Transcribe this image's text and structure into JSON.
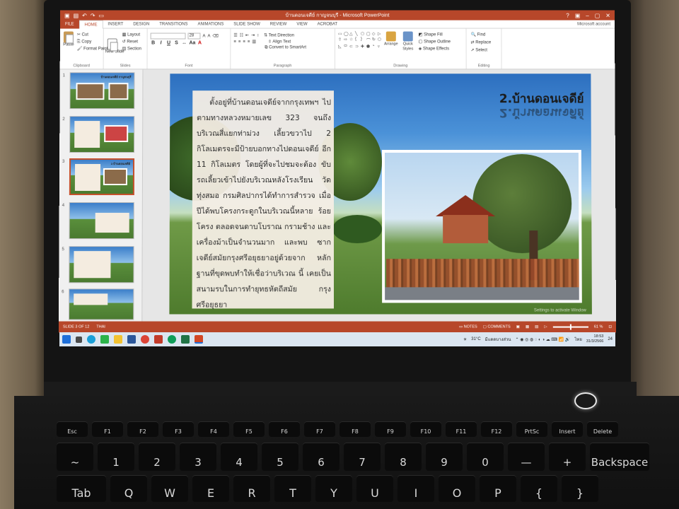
{
  "window": {
    "title": "บ้านดอนเจดีย์ กาญจนบุรี - Microsoft PowerPoint",
    "controls": [
      "?",
      "▣",
      "–",
      "▢",
      "✕"
    ]
  },
  "ribbon_tabs": [
    "FILE",
    "HOME",
    "INSERT",
    "DESIGN",
    "TRANSITIONS",
    "ANIMATIONS",
    "SLIDE SHOW",
    "REVIEW",
    "VIEW",
    "ACROBAT"
  ],
  "active_tab": "HOME",
  "account_label": "Microsoft account",
  "ribbon": {
    "clipboard": {
      "paste": "Paste",
      "cut": "Cut",
      "copy": "Copy",
      "format_painter": "Format Painter",
      "label": "Clipboard"
    },
    "slides": {
      "new_slide": "New Slide",
      "layout": "Layout",
      "reset": "Reset",
      "section": "Section",
      "label": "Slides"
    },
    "font": {
      "size": "28",
      "label": "Font"
    },
    "paragraph": {
      "text_direction": "Text Direction",
      "align_text": "Align Text",
      "convert": "Convert to SmartArt",
      "label": "Paragraph"
    },
    "drawing": {
      "arrange": "Arrange",
      "quick_styles": "Quick Styles",
      "shape_fill": "Shape Fill",
      "shape_outline": "Shape Outline",
      "shape_effects": "Shape Effects",
      "label": "Drawing"
    },
    "editing": {
      "find": "Find",
      "replace": "Replace",
      "select": "Select",
      "label": "Editing"
    }
  },
  "thumbnails": [
    {
      "num": "1",
      "title": "บ้านดอนเจดีย์ กาญจนบุรี"
    },
    {
      "num": "2",
      "title": ""
    },
    {
      "num": "3",
      "title": "2.บ้านดอนเจดีย์"
    },
    {
      "num": "4",
      "title": ""
    },
    {
      "num": "5",
      "title": ""
    },
    {
      "num": "6",
      "title": ""
    }
  ],
  "slide": {
    "title": "2.บ้านดอนเจดีย์",
    "body": "ตั้งอยู่ที่บ้านดอนเจดีย์จากกรุงเทพฯ ไปตามทางหลวงหมายเลข 323 จนถึง บริเวณสี่แยกท่าม่วง เลี้ยวขวาไป 2 กิโลเมตรจะมีป้ายบอกทางไปดอนเจดีย์ อีก 11 กิโลเมตร โดยผู้ที่จะไปชมจะต้อง ขับรถเลี้ยวเข้าไปยังบริเวณหลังโรงเรียน วัดทุ่งสมอ กรมศิลปากรได้ทำการสำรวจ เมื่อปีได้พบโครงกระดูกในบริเวณนี้หลาย ร้อยโครง ตลอดจนดาบโบราณ กรามช้าง และเครื่องม้าเป็นจำนวนมาก และพบ ซากเจดีย์สมัยกรุงศรีอยุธยาอยู่ด้วยจาก หลักฐานที่ขุดพบทำให้เชื่อว่าบริเวณ นี้ เคยเป็นสนามรบในการทำยุทธหัตถีสมัย กรุงศรีอยุธยา",
    "watermark": "Settings to activate Window"
  },
  "status": {
    "slide_info": "SLIDE 3 OF 12",
    "language": "THAI",
    "notes": "NOTES",
    "comments": "COMMENTS",
    "zoom": "61 %"
  },
  "taskbar": {
    "weather_temp": "31°C",
    "weather_text": "มีแดดบางส่วน",
    "lang": "ไทย",
    "time": "18:53",
    "date": "31/3/2566",
    "notif": "24"
  },
  "keyboard": {
    "fn_row": [
      "Esc",
      "F1",
      "F2",
      "F3",
      "F4",
      "F5",
      "F6",
      "F7",
      "F8",
      "F9",
      "F10",
      "F11",
      "F12",
      "PrtSc",
      "Insert",
      "Delete"
    ],
    "num_row": [
      "~",
      "1",
      "2",
      "3",
      "4",
      "5",
      "6",
      "7",
      "8",
      "9",
      "0",
      "—",
      "+",
      "Backspace"
    ],
    "alpha_row": [
      "Tab",
      "Q",
      "W",
      "E",
      "R",
      "T",
      "Y",
      "U",
      "I",
      "O",
      "P",
      "{",
      "}"
    ]
  },
  "colors": {
    "accent": "#b7472a",
    "taskbar": "#dbe6f1"
  }
}
